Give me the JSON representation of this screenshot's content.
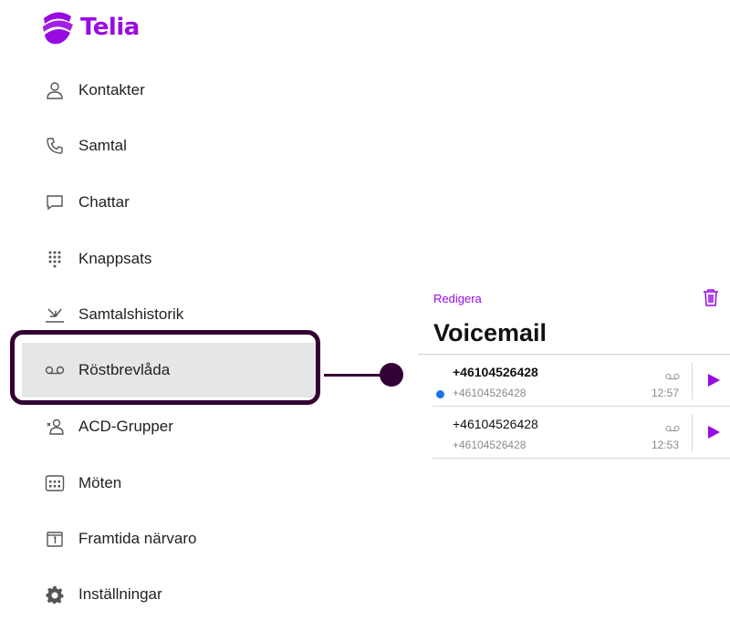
{
  "brand": {
    "name": "Telia",
    "color": "#990ae3"
  },
  "nav": {
    "items": [
      {
        "label": "Kontakter",
        "icon": "person-icon"
      },
      {
        "label": "Samtal",
        "icon": "phone-icon"
      },
      {
        "label": "Chattar",
        "icon": "chat-icon"
      },
      {
        "label": "Knappsats",
        "icon": "dialpad-icon"
      },
      {
        "label": "Samtalshistorik",
        "icon": "call-history-icon"
      },
      {
        "label": "Röstbrevlåda",
        "icon": "voicemail-icon",
        "active": true
      },
      {
        "label": "ACD-Grupper",
        "icon": "group-icon"
      },
      {
        "label": "Möten",
        "icon": "calendar-grid-icon"
      },
      {
        "label": "Framtida närvaro",
        "icon": "calendar-day-icon"
      },
      {
        "label": "Inställningar",
        "icon": "gear-icon"
      }
    ]
  },
  "voicemail": {
    "edit_label": "Redigera",
    "title": "Voicemail",
    "messages": [
      {
        "number": "+46104526428",
        "caller": "+46104526428",
        "time": "12:57",
        "unread": true
      },
      {
        "number": "+46104526428",
        "caller": "+46104526428",
        "time": "12:53",
        "unread": false
      }
    ]
  }
}
